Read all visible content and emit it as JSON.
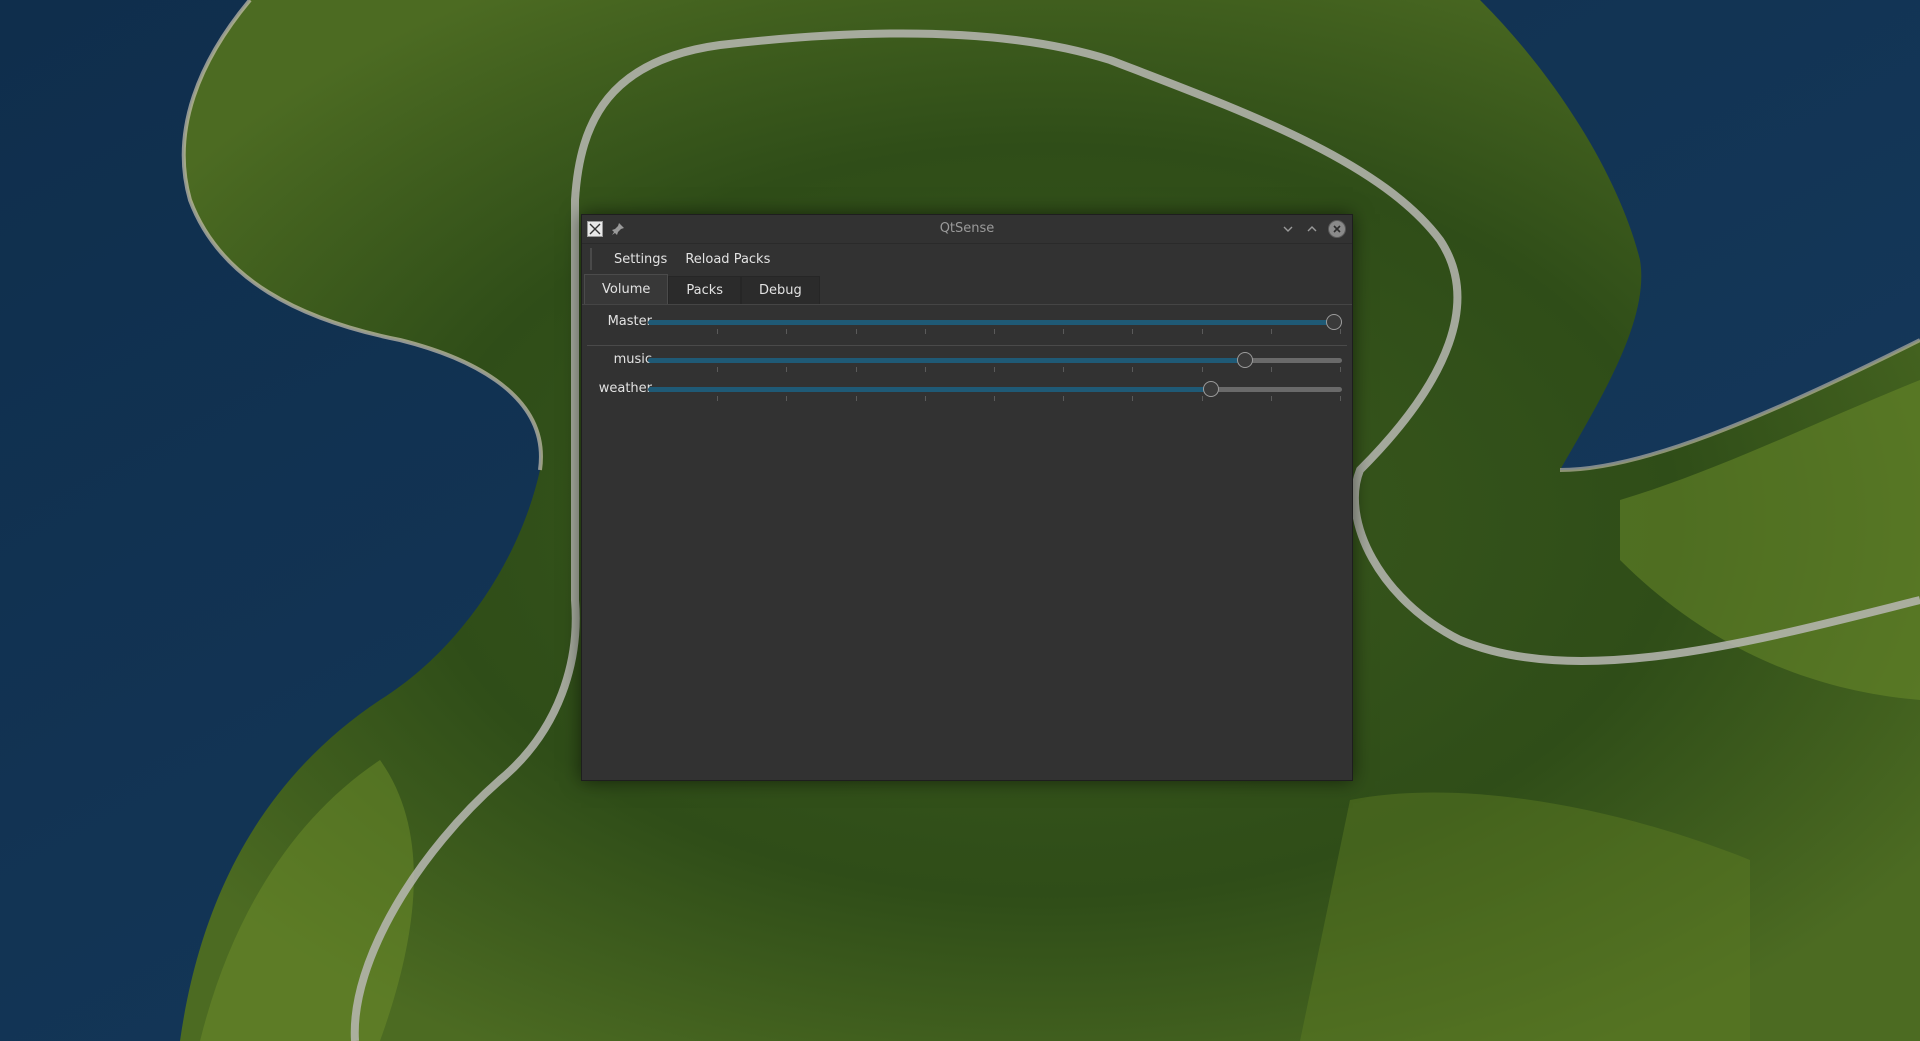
{
  "window": {
    "title": "QtSense"
  },
  "menubar": {
    "items": [
      "Settings",
      "Reload Packs"
    ]
  },
  "tabs": [
    {
      "label": "Volume",
      "active": true
    },
    {
      "label": "Packs",
      "active": false
    },
    {
      "label": "Debug",
      "active": false
    }
  ],
  "volume": {
    "master": {
      "label": "Master",
      "value": 1.0
    },
    "channels": [
      {
        "label": "music",
        "value": 0.87
      },
      {
        "label": "weather",
        "value": 0.82
      }
    ]
  },
  "colors": {
    "window_bg": "#323232",
    "slider_fill": "#1f5a76",
    "slider_track": "#6a6a6a"
  },
  "icons": [
    "app-icon",
    "pin-icon",
    "minimize-icon",
    "maximize-icon",
    "close-icon"
  ]
}
